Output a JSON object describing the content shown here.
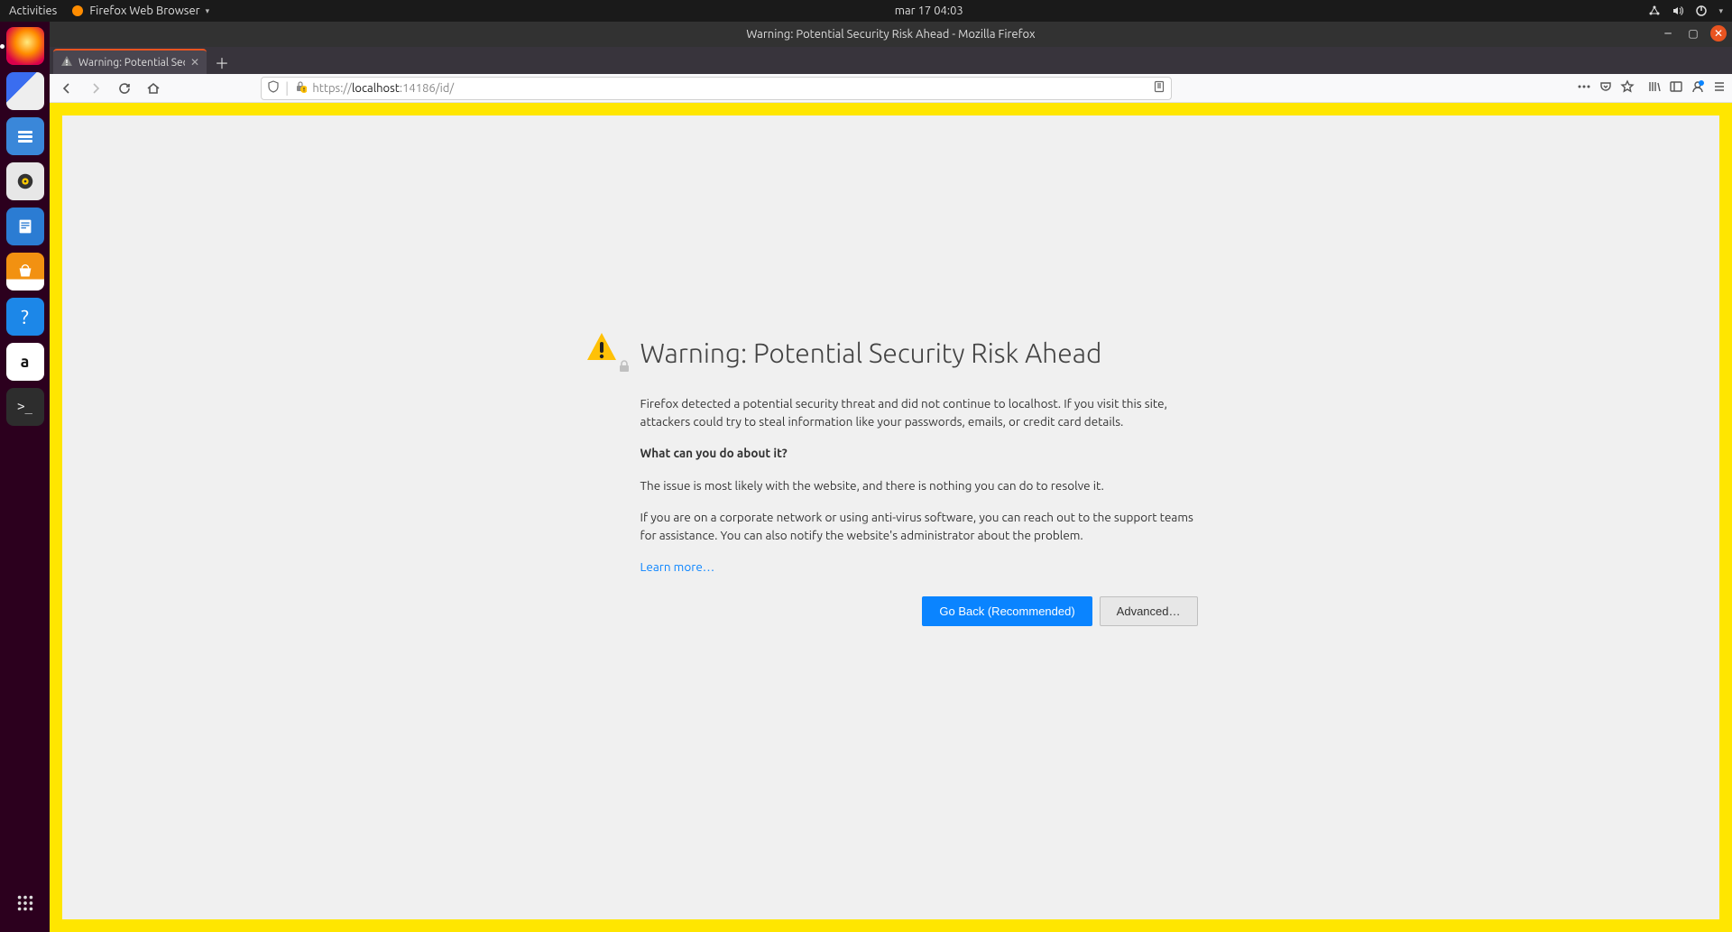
{
  "topbar": {
    "activities": "Activities",
    "app_name": "Firefox Web Browser",
    "clock": "mar 17  04:03"
  },
  "dock": {
    "firefox": "Firefox",
    "thunderbird": "Thunderbird",
    "files": "Files",
    "rhythmbox": "Rhythmbox",
    "writer": "LibreOffice Writer",
    "software": "Ubuntu Software",
    "help": "Help",
    "amazon": "Amazon",
    "amazon_glyph": "a",
    "terminal": "Terminal",
    "terminal_glyph": ">_",
    "grid": "Show Applications"
  },
  "window": {
    "title": "Warning: Potential Security Risk Ahead - Mozilla Firefox"
  },
  "tab": {
    "title": "Warning: Potential Secur"
  },
  "url": {
    "scheme": "https://",
    "host": "localhost",
    "rest": ":14186/id/"
  },
  "error": {
    "title": "Warning: Potential Security Risk Ahead",
    "p1": "Firefox detected a potential security threat and did not continue to localhost. If you visit this site, attackers could try to steal information like your passwords, emails, or credit card details.",
    "heading2": "What can you do about it?",
    "p2": "The issue is most likely with the website, and there is nothing you can do to resolve it.",
    "p3": "If you are on a corporate network or using anti-virus software, you can reach out to the support teams for assistance. You can also notify the website's administrator about the problem.",
    "learn_more": "Learn more…",
    "btn_back": "Go Back (Recommended)",
    "btn_adv": "Advanced…"
  }
}
